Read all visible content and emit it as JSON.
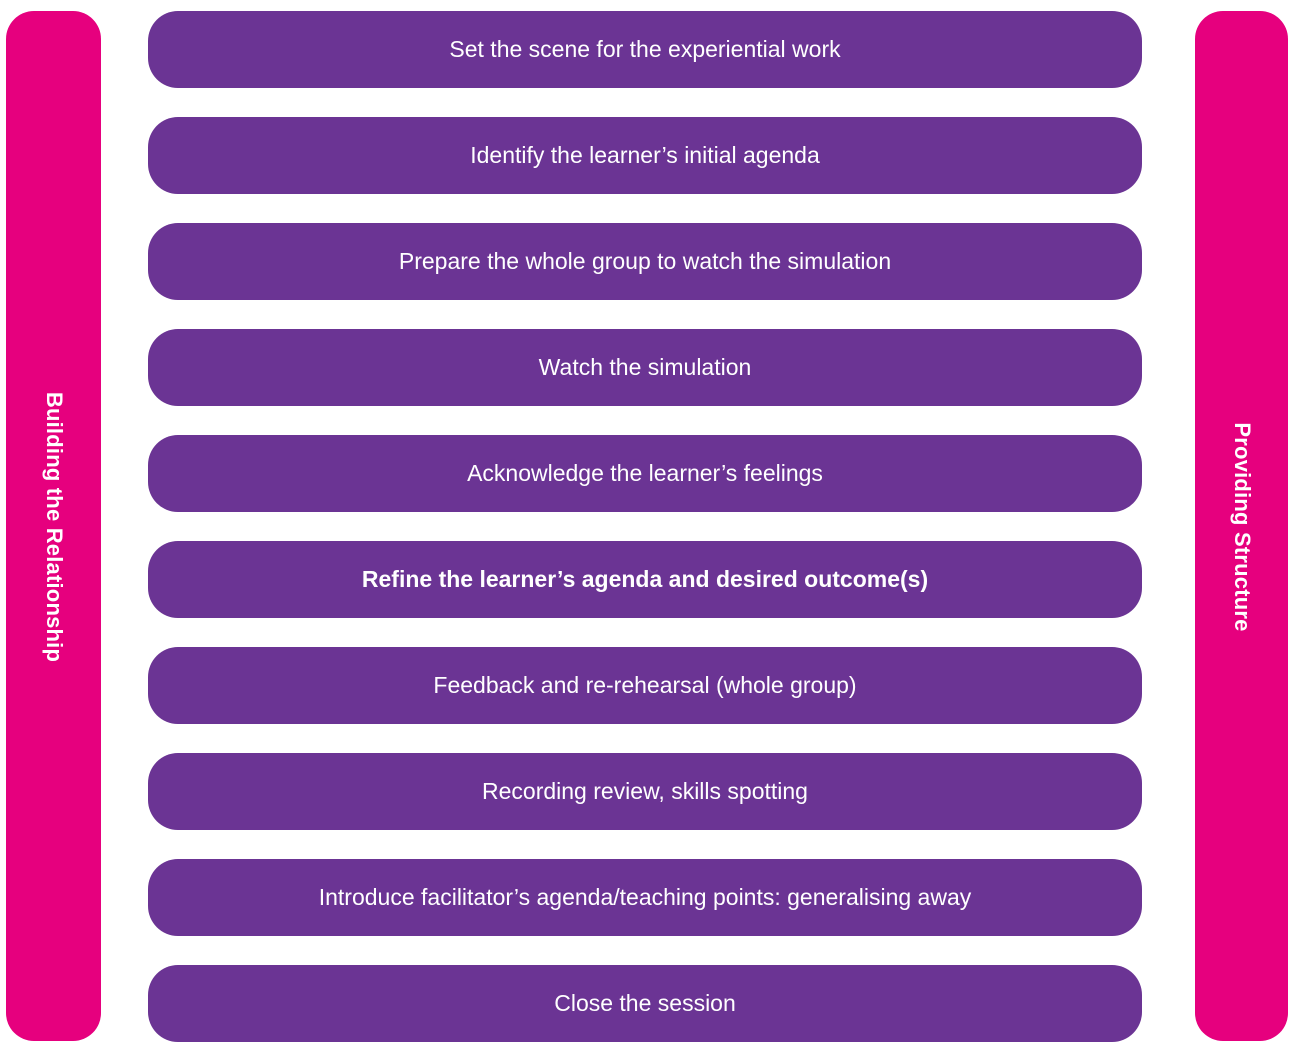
{
  "left_label": "Building the Relationship",
  "right_label": "Providing Structure",
  "steps": [
    {
      "label": "Set the scene for the experiential work"
    },
    {
      "label": "Identify the learner’s initial agenda"
    },
    {
      "label": "Prepare the whole group to watch the simulation"
    },
    {
      "label": "Watch the simulation"
    },
    {
      "label": "Acknowledge the learner’s feelings"
    },
    {
      "label": "Refine the learner’s agenda and desired outcome(s)"
    },
    {
      "label": "Feedback and re-rehearsal (whole group)"
    },
    {
      "label": "Recording review, skills spotting"
    },
    {
      "label": "Introduce facilitator’s agenda/teaching points: generalising away"
    },
    {
      "label": "Close the session"
    }
  ],
  "colors": {
    "side_bar": "#e6007e",
    "step": "#6b3494",
    "text": "#ffffff"
  }
}
